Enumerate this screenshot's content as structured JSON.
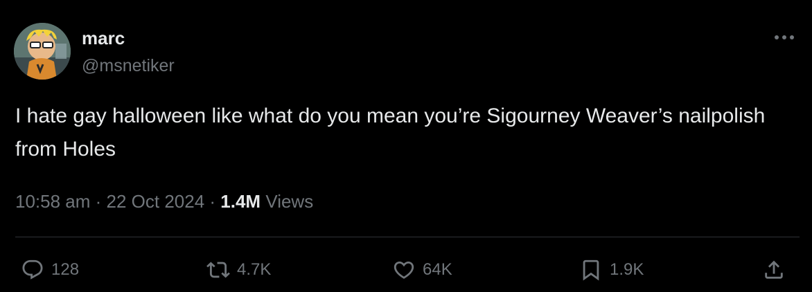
{
  "user": {
    "display_name": "marc",
    "handle": "@msnetiker"
  },
  "tweet": {
    "text": "I hate gay halloween like what do you mean you’re Sigourney Weaver’s nailpolish from Holes",
    "time": "10:58 am",
    "separator": " · ",
    "date": "22 Oct 2024",
    "views_count": "1.4M",
    "views_label": " Views"
  },
  "actions": {
    "replies": "128",
    "reposts": "4.7K",
    "likes": "64K",
    "bookmarks": "1.9K"
  },
  "icons": {
    "more": "more-horizontal-icon",
    "reply": "reply-bubble-icon",
    "repost": "repost-arrows-icon",
    "like": "heart-icon",
    "bookmark": "bookmark-icon",
    "share": "share-upload-icon"
  },
  "colors": {
    "background": "#000000",
    "primary_text": "#e7e9ea",
    "secondary_text": "#71767b",
    "divider": "#2f3336"
  }
}
